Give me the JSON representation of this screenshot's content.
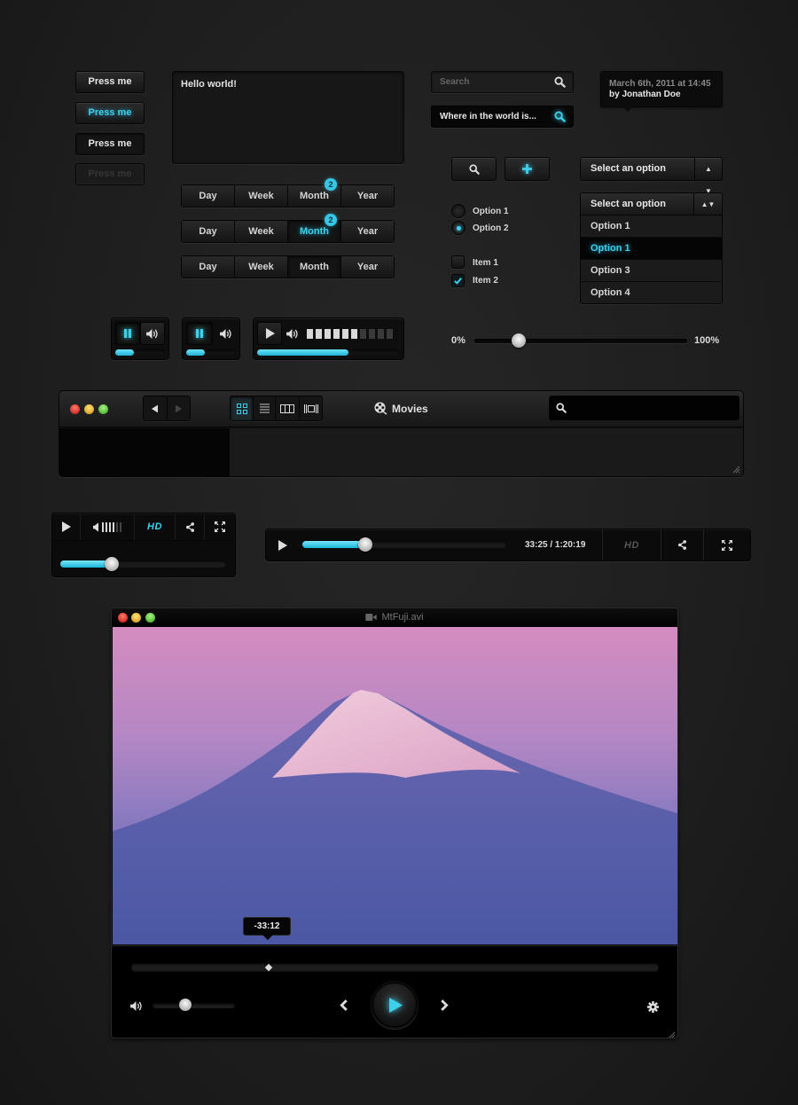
{
  "colors": {
    "accent": "#3fd0ec",
    "background": "#1e1e1e",
    "dark_panel": "#0b0b0b"
  },
  "press_buttons": [
    {
      "label": "Press me",
      "state": "default"
    },
    {
      "label": "Press me",
      "state": "active"
    },
    {
      "label": "Press me",
      "state": "pressed"
    },
    {
      "label": "Press me",
      "state": "disabled"
    }
  ],
  "textarea": {
    "value": "Hello world!"
  },
  "segmented_controls": [
    {
      "items": [
        "Day",
        "Week",
        "Month",
        "Year"
      ],
      "badge_item": "Month",
      "badge": "2",
      "selected": null
    },
    {
      "items": [
        "Day",
        "Week",
        "Month",
        "Year"
      ],
      "badge_item": "Month",
      "badge": "2",
      "selected": "Month"
    },
    {
      "items": [
        "Day",
        "Week",
        "Month",
        "Year"
      ],
      "badge_item": null,
      "badge": null,
      "selected": "Month"
    }
  ],
  "search": {
    "placeholder": "Search",
    "value": ""
  },
  "search_active": {
    "value": "Where in the world is..."
  },
  "tooltip": {
    "date": "March 6th, 2011 at 14:45",
    "author": "by Jonathan Doe"
  },
  "icon_buttons": [
    {
      "icon": "search-icon"
    },
    {
      "icon": "plus-icon"
    }
  ],
  "select": {
    "label": "Select an option",
    "icon": "up-down-arrows-icon"
  },
  "dropdown": {
    "label": "Select an option",
    "options": [
      "Option 1",
      "Option 1",
      "Option 3",
      "Option 4"
    ],
    "selected_index": 1
  },
  "radios": [
    {
      "label": "Option 1",
      "checked": false
    },
    {
      "label": "Option 2",
      "checked": true
    }
  ],
  "checkboxes": [
    {
      "label": "Item 1",
      "checked": false
    },
    {
      "label": "Item 2",
      "checked": true
    }
  ],
  "mini_players": [
    {
      "state": "playing",
      "progress": 0.38,
      "toggle_pressed": "pause"
    },
    {
      "state": "playing",
      "progress": 0.38,
      "toggle_pressed": "pause"
    },
    {
      "state": "paused",
      "progress": 0.64,
      "volume_steps": 10,
      "volume_level": 6
    }
  ],
  "range_slider": {
    "min_label": "0%",
    "max_label": "100%",
    "value": 0.21
  },
  "finder": {
    "title": "Movies",
    "title_icon": "film-reel-icon",
    "view_modes": [
      "grid-view-icon",
      "list-view-icon",
      "column-view-icon",
      "coverflow-view-icon"
    ],
    "active_view": 0,
    "search_value": ""
  },
  "video_player_small": {
    "volume_steps": 6,
    "volume_level": 4,
    "hd_label": "HD",
    "hd_active": true,
    "progress": 0.31
  },
  "video_player_wide": {
    "time": "33:25 / 1:20:19",
    "hd_label": "HD",
    "hd_active": false,
    "progress": 0.31
  },
  "movie_window": {
    "title": "MtFuji.avi",
    "title_icon": "video-camera-icon",
    "hover_time": "-33:12",
    "scrub_position": 0.26,
    "volume": 0.4
  }
}
